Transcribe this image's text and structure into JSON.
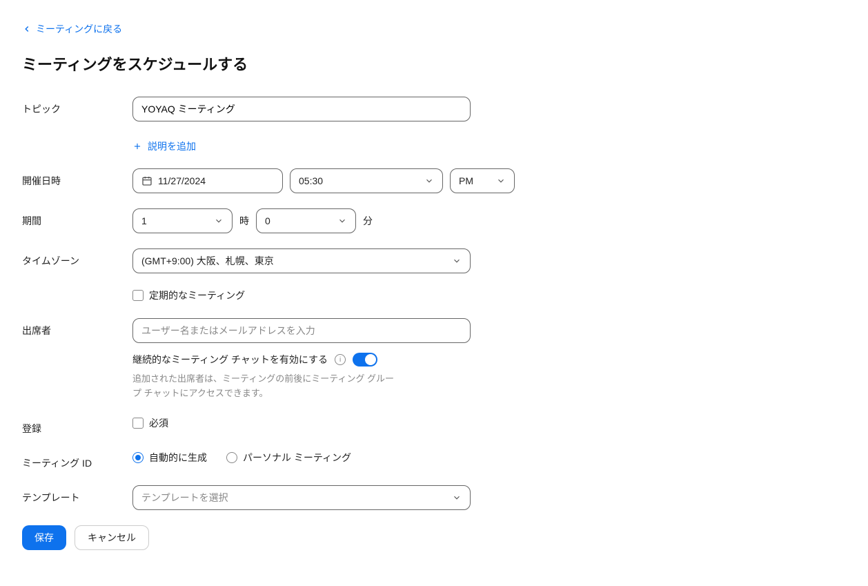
{
  "back_link": "ミーティングに戻る",
  "page_title": "ミーティングをスケジュールする",
  "labels": {
    "topic": "トピック",
    "when": "開催日時",
    "duration": "期間",
    "timezone": "タイムゾーン",
    "attendees": "出席者",
    "registration": "登録",
    "meeting_id": "ミーティング ID",
    "template": "テンプレート"
  },
  "topic": {
    "value": "YOYAQ ミーティング"
  },
  "add_description": "説明を追加",
  "when": {
    "date": "11/27/2024",
    "time": "05:30",
    "ampm": "PM"
  },
  "duration": {
    "hours": "1",
    "minutes": "0",
    "hours_unit": "時",
    "minutes_unit": "分"
  },
  "timezone": {
    "value": "(GMT+9:00) 大阪、札幌、東京"
  },
  "recurring": {
    "label": "定期的なミーティング"
  },
  "attendees": {
    "placeholder": "ユーザー名またはメールアドレスを入力"
  },
  "chat": {
    "label": "継続的なミーティング チャットを有効にする",
    "helper": "追加された出席者は、ミーティングの前後にミーティング グループ チャットにアクセスできます。"
  },
  "registration": {
    "required_label": "必須"
  },
  "meeting_id": {
    "auto": "自動的に生成",
    "personal": "パーソナル ミーティング"
  },
  "template": {
    "placeholder": "テンプレートを選択"
  },
  "actions": {
    "save": "保存",
    "cancel": "キャンセル"
  }
}
